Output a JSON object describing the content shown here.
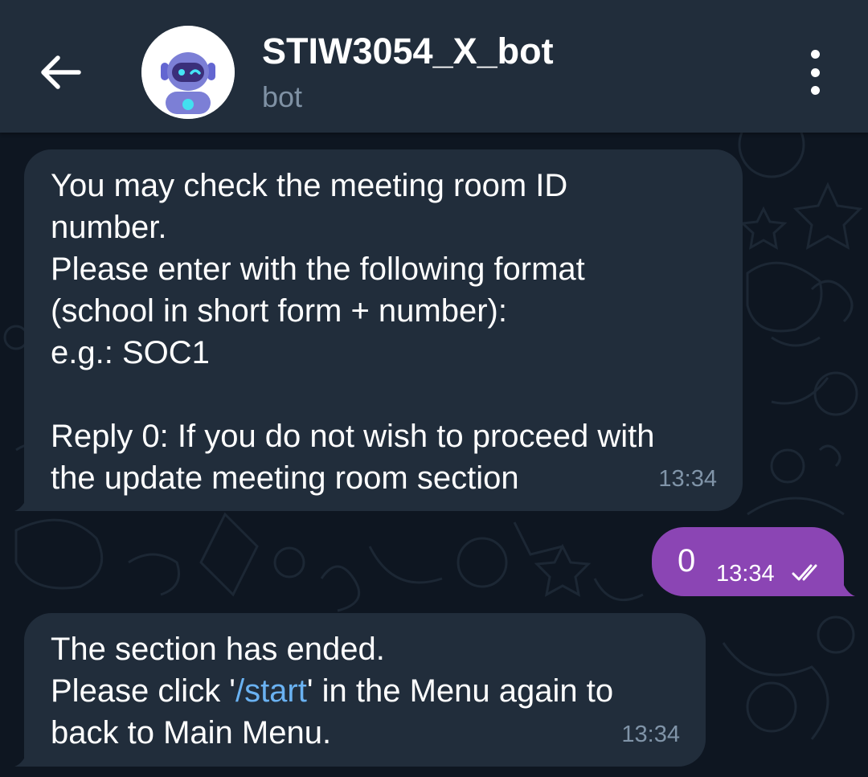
{
  "header": {
    "back_icon": "arrow-left-icon",
    "avatar_icon": "robot-avatar-icon",
    "title": "STIW3054_X_bot",
    "subtitle": "bot",
    "menu_icon": "more-vertical-icon"
  },
  "messages": [
    {
      "direction": "incoming",
      "text": "You may check the meeting room ID\nnumber.\nPlease enter with the following format\n(school in short form + number):\ne.g.: SOC1\n\nReply 0: If you do not wish to proceed with\nthe update meeting room section",
      "time": "13:34"
    },
    {
      "direction": "outgoing",
      "text": "0",
      "time": "13:34",
      "status_icon": "double-check-icon"
    },
    {
      "direction": "incoming",
      "text_before_link": "The section has ended.\nPlease click '",
      "link_text": "/start",
      "text_after_link": "' in the Menu again to\nback to Main Menu.",
      "time": "13:34"
    }
  ],
  "colors": {
    "header_bg": "#212d3b",
    "chat_bg": "#0e1621",
    "incoming_bubble": "#212d3b",
    "outgoing_bubble": "#8b45b4",
    "link": "#6ab2f2",
    "subtitle": "#7f91a4"
  }
}
